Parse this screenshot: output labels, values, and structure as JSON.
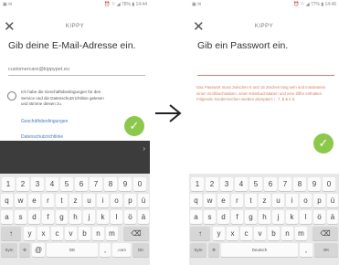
{
  "screens": [
    {
      "status_left": "▣ ✉",
      "status_right": "⏰ ⚐ ◢ 78% ▮ 14:44",
      "app_name": "KIPPY",
      "title": "Gib deine E-Mail-Adresse ein.",
      "email_placeholder": "customercare@kippypet.eu",
      "terms_text": "Ich habe die Geschäftsbedingungen für den Service und die Datenschutzrichtlinie gelesen und stimme diesen zu.",
      "link_terms": "Geschäftsbedingungen",
      "link_privacy": "Datenschutzrichtlinie",
      "check_icon": "✓",
      "kb_chevron": "›",
      "numbers": [
        "1",
        "2",
        "3",
        "4",
        "5",
        "6",
        "7",
        "8",
        "9",
        "0"
      ],
      "row1": [
        "q",
        "w",
        "e",
        "r",
        "t",
        "z",
        "u",
        "i",
        "o",
        "p",
        "ü"
      ],
      "row2": [
        "a",
        "s",
        "d",
        "f",
        "g",
        "h",
        "j",
        "k",
        "l",
        "ö",
        "ä"
      ],
      "row3": [
        "y",
        "x",
        "c",
        "v",
        "b",
        "n",
        "m"
      ],
      "shift": "↑",
      "backspace": "⌫",
      "sym": "Sym",
      "settings": "⚙",
      "at": "@",
      "space": "DE",
      "comma": ",",
      "dotcom": ".com",
      "ok": "OK"
    },
    {
      "status_left": "▣ ✉",
      "status_right": "⏰ ⚐ ◢ 77% ▮ 14:46",
      "app_name": "KIPPY",
      "title": "Gib ein Passwort ein.",
      "hint_text": "Das Passwort muss zwischen 6 und 16 Zeichen lang sein und mindestens einen Großbuchstaben, einen Kleinbuchstaben und eine Ziffer enthalten. Folgende Sonderzeichen werden akzeptiert: !, ?, $ & £ €.",
      "check_icon": "✓",
      "numbers": [
        "1",
        "2",
        "3",
        "4",
        "5",
        "6",
        "7",
        "8",
        "9",
        "0"
      ],
      "row1": [
        "q",
        "w",
        "e",
        "r",
        "t",
        "z",
        "u",
        "i",
        "o",
        "p",
        "ü"
      ],
      "row2": [
        "a",
        "s",
        "d",
        "f",
        "g",
        "h",
        "j",
        "k",
        "l",
        "ö",
        "ä"
      ],
      "row3": [
        "y",
        "x",
        "c",
        "v",
        "b",
        "n",
        "m"
      ],
      "shift": "↑",
      "backspace": "⌫",
      "sym": "Sym",
      "settings": "⚙",
      "space": "Deutsch",
      "comma": ",",
      "ok": "OK"
    }
  ],
  "colors": {
    "accent_green": "#8cc84b",
    "link_blue": "#4a7cc2",
    "hint_orange": "#d08060"
  },
  "icons": {
    "close": "close-icon",
    "check": "checkmark-icon",
    "arrow": "right-arrow-icon"
  }
}
